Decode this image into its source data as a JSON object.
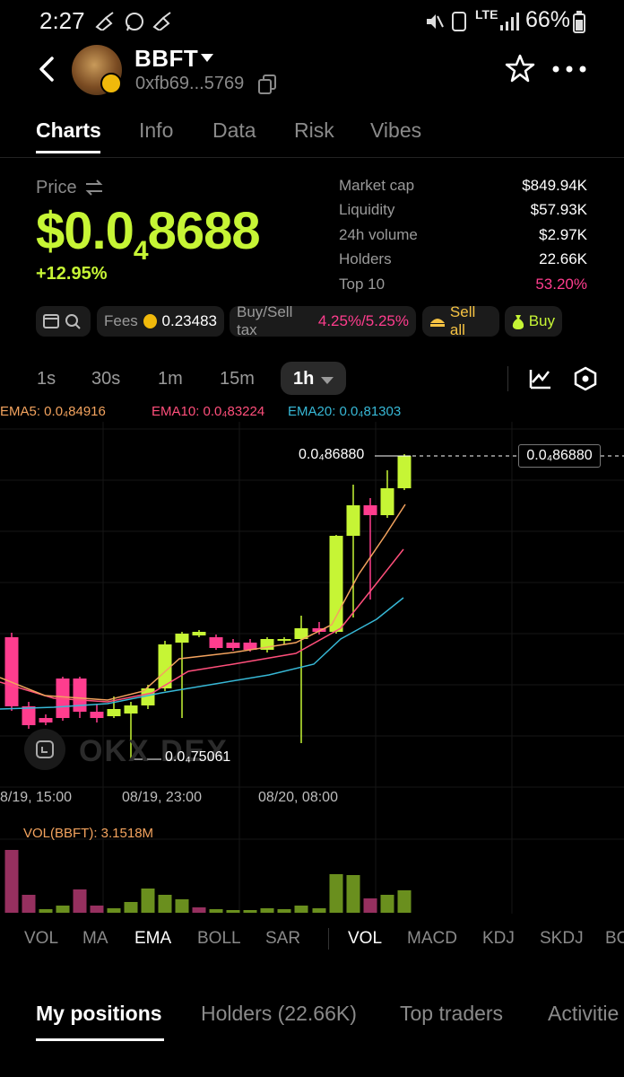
{
  "status_bar": {
    "time": "2:27",
    "battery_pct": "66%",
    "network": "LTE",
    "icons": [
      "broom-icon",
      "whatsapp-icon",
      "broom-icon",
      "mute-icon",
      "sim-icon",
      "lte-icon",
      "signal-icon",
      "battery-icon"
    ]
  },
  "header": {
    "token_name": "BBFT",
    "address": "0xfb69...5769"
  },
  "tabs": [
    {
      "label": "Charts",
      "active": true
    },
    {
      "label": "Info"
    },
    {
      "label": "Data"
    },
    {
      "label": "Risk"
    },
    {
      "label": "Vibes"
    }
  ],
  "price": {
    "label": "Price",
    "value_prefix": "$0.0",
    "value_sub": "4",
    "value_suffix": "8688",
    "change": "+12.95%"
  },
  "stats": [
    {
      "label": "Market cap",
      "value": "$849.94K"
    },
    {
      "label": "Liquidity",
      "value": "$57.93K"
    },
    {
      "label": "24h volume",
      "value": "$2.97K"
    },
    {
      "label": "Holders",
      "value": "22.66K"
    },
    {
      "label": "Top 10",
      "value": "53.20%"
    }
  ],
  "chips": {
    "fees_label": "Fees",
    "fees_value": "0.23483",
    "tax_label": "Buy/Sell tax",
    "buy_tax": "4.25%",
    "tax_sep": "/",
    "sell_tax": "5.25%",
    "sell_all": "Sell all",
    "buy": "Buy"
  },
  "intervals": {
    "items": [
      "1s",
      "30s",
      "1m",
      "15m"
    ],
    "selected": "1h"
  },
  "ema_legend": {
    "ema5": "EMA5: 0.0₄84916",
    "ema10": "EMA10: 0.0₄83224",
    "ema20": "EMA20: 0.0₄81303"
  },
  "chart_data": {
    "type": "candlestick",
    "high_label": "0.0₄86880",
    "current_label": "0.0₄86880",
    "low_label": "0.0₄75061",
    "x_ticks": [
      "8/19, 15:00",
      "08/19, 23:00",
      "08/20, 08:00"
    ],
    "watermark": "OKX DEX",
    "vol_label": "VOL(BBFT): 3.1518M"
  },
  "indicators": {
    "main": [
      "VOL",
      "MA",
      "EMA",
      "BOLL",
      "SAR"
    ],
    "sub": [
      "VOL",
      "MACD",
      "KDJ",
      "SKDJ",
      "BO"
    ]
  },
  "bottom_tabs": [
    "My positions",
    "Holders (22.66K)",
    "Top traders",
    "Activitie"
  ],
  "colors": {
    "up": "#c6f535",
    "down": "#ff3d8e",
    "ema5": "#f3a35e",
    "ema10": "#ff4f7b",
    "ema20": "#37b8d6"
  }
}
